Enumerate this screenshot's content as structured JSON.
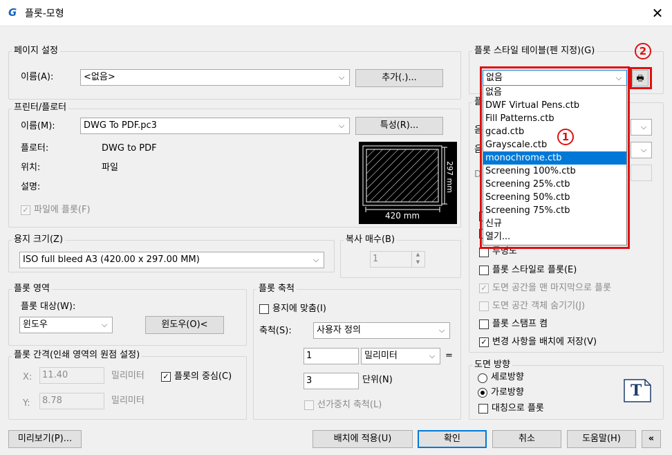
{
  "window": {
    "title": "플롯-모형",
    "logo": "G",
    "close": "✕"
  },
  "page_setup": {
    "group": "페이지 설정",
    "name_label": "이름(A):",
    "name_value": "<없음>",
    "add_button": "추가(.)..."
  },
  "printer": {
    "group": "프린터/플로터",
    "name_label": "이름(M):",
    "name_value": "DWG To PDF.pc3",
    "props_button": "특성(R)...",
    "plotter_label": "플로터:",
    "plotter_value": "DWG to PDF",
    "location_label": "위치:",
    "location_value": "파일",
    "desc_label": "설명:",
    "plot_to_file": "파일에 플롯(F)",
    "plot_to_file_checked": true,
    "preview_width": "420 mm",
    "preview_height": "297 mm"
  },
  "paper": {
    "group": "용지 크기(Z)",
    "value": "ISO full bleed A3 (420.00 x 297.00 MM)"
  },
  "copies": {
    "group": "복사 매수(B)",
    "value": "1"
  },
  "plot_area": {
    "group": "플롯 영역",
    "target_label": "플롯 대상(W):",
    "target_value": "윈도우",
    "window_button": "윈도우(O)<"
  },
  "plot_offset": {
    "group": "플롯 간격(인쇄 영역의 원점 설정)",
    "x_label": "X:",
    "x_value": "11.40",
    "x_unit": "밀리미터",
    "y_label": "Y:",
    "y_value": "8.78",
    "y_unit": "밀리미터",
    "center": "플롯의 중심(C)",
    "center_checked": true
  },
  "plot_scale": {
    "group": "플롯 축척",
    "fit": "용지에 맞춤(I)",
    "fit_checked": false,
    "scale_label": "축척(S):",
    "scale_value": "사용자 정의",
    "num_value": "1",
    "num_unit": "밀리미터",
    "equals": "=",
    "den_value": "3",
    "den_unit": "단위(N)",
    "lineweights": "선가중치 축척(L)"
  },
  "style_table": {
    "group": "플롯 스타일 테이블(펜 지정)(G)",
    "selected": "없음",
    "items": [
      "없음",
      "DWF Virtual Pens.ctb",
      "Fill Patterns.ctb",
      "gcad.ctb",
      "Grayscale.ctb",
      "monochrome.ctb",
      "Screening 100%.ctb",
      "Screening 25%.ctb",
      "Screening 50%.ctb",
      "Screening 75%.ctb",
      "신규",
      "열기..."
    ],
    "highlighted_index": 5
  },
  "plot_options": {
    "group_fragment": "플",
    "hidden_fragment_1": "음",
    "hidden_fragment_2": "음",
    "hidden_fragment_3": "D",
    "transparency_fragment": "투명도",
    "items": [
      {
        "label": "플롯 스타일로 플롯(E)",
        "checked": false,
        "disabled": false
      },
      {
        "label": "도면 공간을 맨 마지막으로 플롯",
        "checked": true,
        "disabled": true
      },
      {
        "label": "도면 공간 객체 숨기기(J)",
        "checked": false,
        "disabled": true
      },
      {
        "label": "플롯 스탬프 켬",
        "checked": false,
        "disabled": false
      },
      {
        "label": "변경 사항을 배치에 저장(V)",
        "checked": true,
        "disabled": false
      }
    ]
  },
  "orientation": {
    "group": "도면 방향",
    "portrait": "세로방향",
    "landscape": "가로방향",
    "landscape_selected": true,
    "upside_down": "대칭으로 플롯",
    "icon_letter": "T"
  },
  "annotations": {
    "one": "1",
    "two": "2"
  },
  "footer": {
    "preview": "미리보기(P)...",
    "apply": "배치에 적용(U)",
    "ok": "확인",
    "cancel": "취소",
    "help": "도움말(H)",
    "collapse": "«"
  },
  "colors": {
    "accent": "#0078d7",
    "annotation_red": "#e01010",
    "logo_blue": "#1565c0"
  }
}
